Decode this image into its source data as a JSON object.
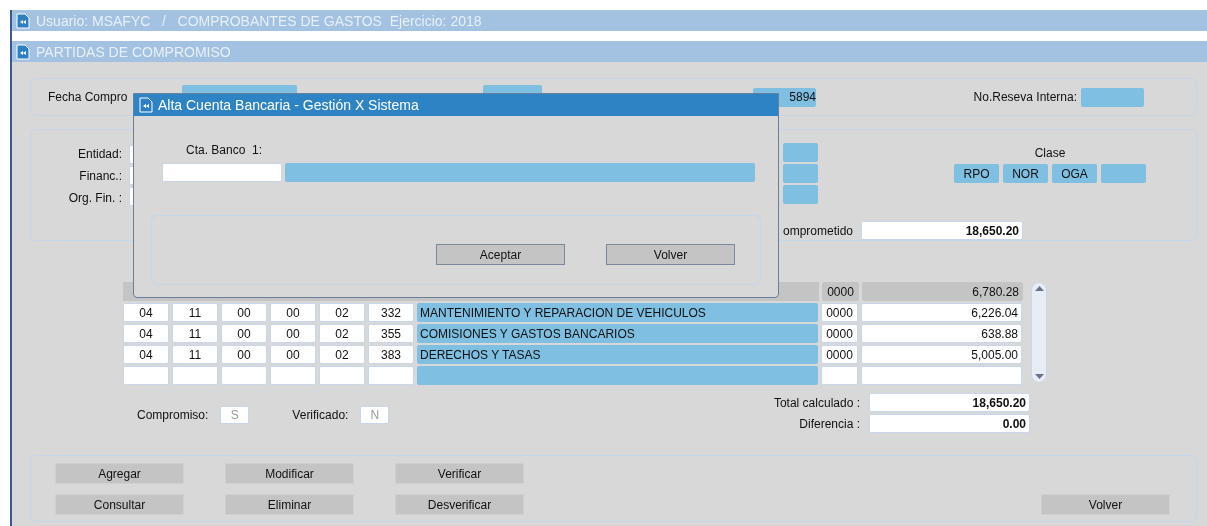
{
  "window": {
    "title": "Usuario: MSAFYC   /   COMPROBANTES DE GASTOS  Ejercicio: 2018"
  },
  "form": {
    "title": "PARTIDAS DE COMPROMISO"
  },
  "header": {
    "fecha_label": "Fecha Compro",
    "no_original": "5894",
    "reserva_label": "No.Reseva Interna:"
  },
  "origin": {
    "labels": [
      "Entidad:",
      "Financ.:",
      "Org. Fin. :"
    ],
    "clase_label": "Clase",
    "clase": [
      "RPO",
      "NOR",
      "OGA"
    ],
    "comprometido_label": "omprometido",
    "comprometido": "18,650.20"
  },
  "partidas": {
    "rows": [
      {
        "selected": true,
        "code": "0000",
        "amount": "6,780.28"
      },
      {
        "selected": false,
        "segments": [
          "04",
          "11",
          "00",
          "00",
          "02",
          "332"
        ],
        "description": "MANTENIMIENTO Y REPARACION DE VEHICULOS",
        "code": "0000",
        "amount": "6,226.04"
      },
      {
        "selected": false,
        "segments": [
          "04",
          "11",
          "00",
          "00",
          "02",
          "355"
        ],
        "description": "COMISIONES Y GASTOS BANCARIOS",
        "code": "0000",
        "amount": "638.88"
      },
      {
        "selected": false,
        "segments": [
          "04",
          "11",
          "00",
          "00",
          "02",
          "383"
        ],
        "description": "DERECHOS Y TASAS",
        "code": "0000",
        "amount": "5,005.00"
      }
    ]
  },
  "flags": [
    {
      "label": "Compromiso:",
      "value": "S",
      "disabled": true
    },
    {
      "label": "Verificado:",
      "value": "N",
      "disabled": true
    }
  ],
  "totals": [
    {
      "label": "Total calculado :",
      "value": "18,650.20"
    },
    {
      "label": "Diferencia :",
      "value": "0.00"
    }
  ],
  "actions": [
    [
      "Agregar",
      "Modificar",
      "Verificar"
    ],
    [
      "Consultar",
      "Eliminar",
      "Desverificar",
      "Volver"
    ]
  ],
  "dialog": {
    "title": "Alta Cuenta Bancaria - Gestión X Sistema",
    "field_label": "Cta. Banco  1:",
    "buttons": [
      "Aceptar",
      "Volver"
    ]
  }
}
